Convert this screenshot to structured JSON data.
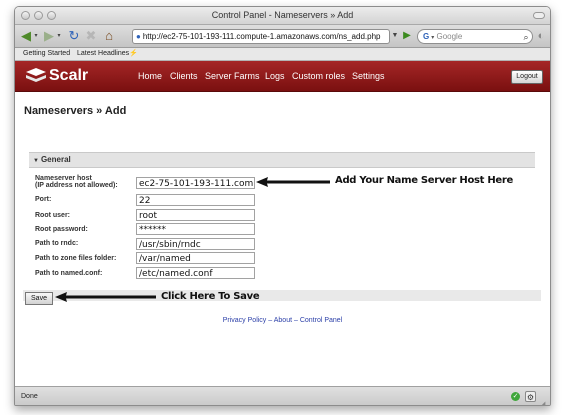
{
  "window": {
    "title": "Control Panel - Nameservers » Add"
  },
  "toolbar": {
    "url": "http://ec2-75-101-193-111.compute-1.amazonaws.com/ns_add.php",
    "search_placeholder": "Google"
  },
  "bookmarks": [
    "Getting Started",
    "Latest Headlines"
  ],
  "app": {
    "logo": "Scalr",
    "nav": [
      "Home",
      "Clients",
      "Server Farms",
      "Logs",
      "Custom roles",
      "Settings"
    ],
    "logout_label": "Logout"
  },
  "page": {
    "title": "Nameservers » Add",
    "section_label": "General",
    "fields": [
      {
        "label": "Nameserver host",
        "sublabel": "(IP address not allowed):",
        "value": "ec2-75-101-193-111.com"
      },
      {
        "label": "Port:",
        "value": "22"
      },
      {
        "label": "Root user:",
        "value": "root"
      },
      {
        "label": "Root password:",
        "value": "******"
      },
      {
        "label": "Path to rndc:",
        "value": "/usr/sbin/rndc"
      },
      {
        "label": "Path to zone files folder:",
        "value": "/var/named"
      },
      {
        "label": "Path to named.conf:",
        "value": "/etc/named.conf"
      }
    ],
    "save_label": "Save",
    "callout_host": "Add Your Name Server Host Here",
    "callout_save": "Click Here To Save",
    "footer": {
      "privacy": "Privacy Policy",
      "about": "About",
      "control": "Control Panel",
      "sep": "–"
    }
  },
  "status": {
    "text": "Done"
  }
}
